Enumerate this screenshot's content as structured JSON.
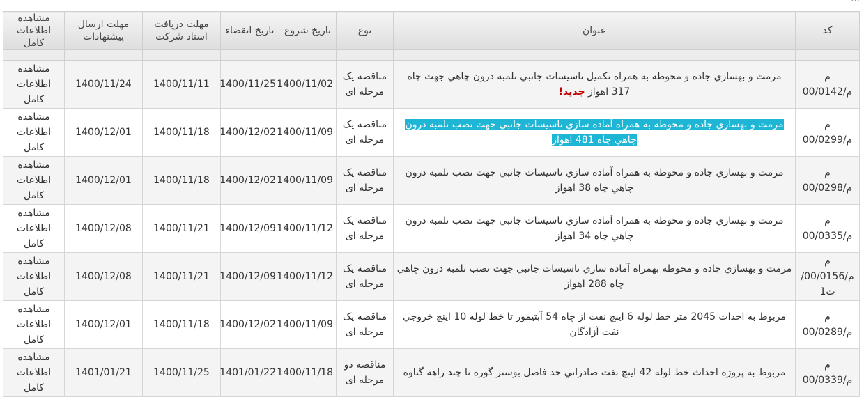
{
  "top_text": "…",
  "headers": {
    "code": "کد",
    "title": "عنوان",
    "type": "نوع",
    "start_date": "تاریخ شروع",
    "expiry_date": "تاریخ انقضاء",
    "doc_deadline": "مهلت دریافت اسناد شرکت",
    "proposal_deadline": "مهلت ارسال پیشنهادات",
    "view_full": "مشاهده اطلاعات کامل"
  },
  "rows": [
    {
      "code": "م م/00/0142",
      "title": "مرمت و بهسازي جاده و محوطه به همراه تكميل تاسيسات جانبي تلمبه درون چاهي جهت چاه 317 اهواز",
      "new_label": "جدید!",
      "type": "مناقصه یک مرحله ای",
      "start": "1400/11/02",
      "expiry": "1400/11/25",
      "doc_deadline": "1400/11/11",
      "proposal_deadline": "1400/11/24",
      "view": "مشاهده اطلاعات کامل"
    },
    {
      "code": "م م/00/0299",
      "title": "مرمت و بهسازي جاده و محوطه به همراه آماده سازي تاسيسات جانبي جهت نصب تلمبه درون چاهي چاه 481 اهواز",
      "type": "مناقصه یک مرحله ای",
      "start": "1400/11/09",
      "expiry": "1400/12/02",
      "doc_deadline": "1400/11/18",
      "proposal_deadline": "1400/12/01",
      "view": "مشاهده اطلاعات کامل"
    },
    {
      "code": "م م/00/0298",
      "title": "مرمت و بهسازي جاده و محوطه به همراه آماده سازي تاسيسات جانبي جهت نصب تلمبه درون چاهي چاه 38 اهواز",
      "type": "مناقصه یک مرحله ای",
      "start": "1400/11/09",
      "expiry": "1400/12/02",
      "doc_deadline": "1400/11/18",
      "proposal_deadline": "1400/12/01",
      "view": "مشاهده اطلاعات کامل"
    },
    {
      "code": "م م/00/0335",
      "title": "مرمت و بهسازي جاده و محوطه به همراه آماده سازي تاسيسات جانبي جهت نصب تلمبه درون چاهي چاه 34 اهواز",
      "type": "مناقصه یک مرحله ای",
      "start": "1400/11/12",
      "expiry": "1400/12/09",
      "doc_deadline": "1400/11/21",
      "proposal_deadline": "1400/12/08",
      "view": "مشاهده اطلاعات کامل"
    },
    {
      "code": "م م/00/0156/ت1",
      "title": "مرمت و بهسازي جاده و محوطه بهمراه آماده سازي تاسيسات جانبي جهت نصب تلمبه درون چاهي چاه 288 اهواز",
      "type": "مناقصه یک مرحله ای",
      "start": "1400/11/12",
      "expiry": "1400/12/09",
      "doc_deadline": "1400/11/21",
      "proposal_deadline": "1400/12/08",
      "view": "مشاهده اطلاعات کامل"
    },
    {
      "code": "م م/00/0289",
      "title": "مربوط به احداث 2045 متر خط لوله 6 اينچ نفت از چاه 54 آبتيمور تا خط لوله 10 اينچ خروجي نفت آزادگان",
      "type": "مناقصه یک مرحله ای",
      "start": "1400/11/09",
      "expiry": "1400/12/02",
      "doc_deadline": "1400/11/18",
      "proposal_deadline": "1400/12/01",
      "view": "مشاهده اطلاعات کامل"
    },
    {
      "code": "م م/00/0339",
      "title": "مربوط به پروژه احداث خط لوله 42 اينچ نفت صادراتي حد فاصل بوستر گوره تا چند راهه گناوه",
      "type": "مناقصه دو مرحله ای",
      "start": "1400/11/18",
      "expiry": "1401/01/22",
      "doc_deadline": "1400/11/25",
      "proposal_deadline": "1401/01/21",
      "view": "مشاهده اطلاعات کامل"
    }
  ]
}
